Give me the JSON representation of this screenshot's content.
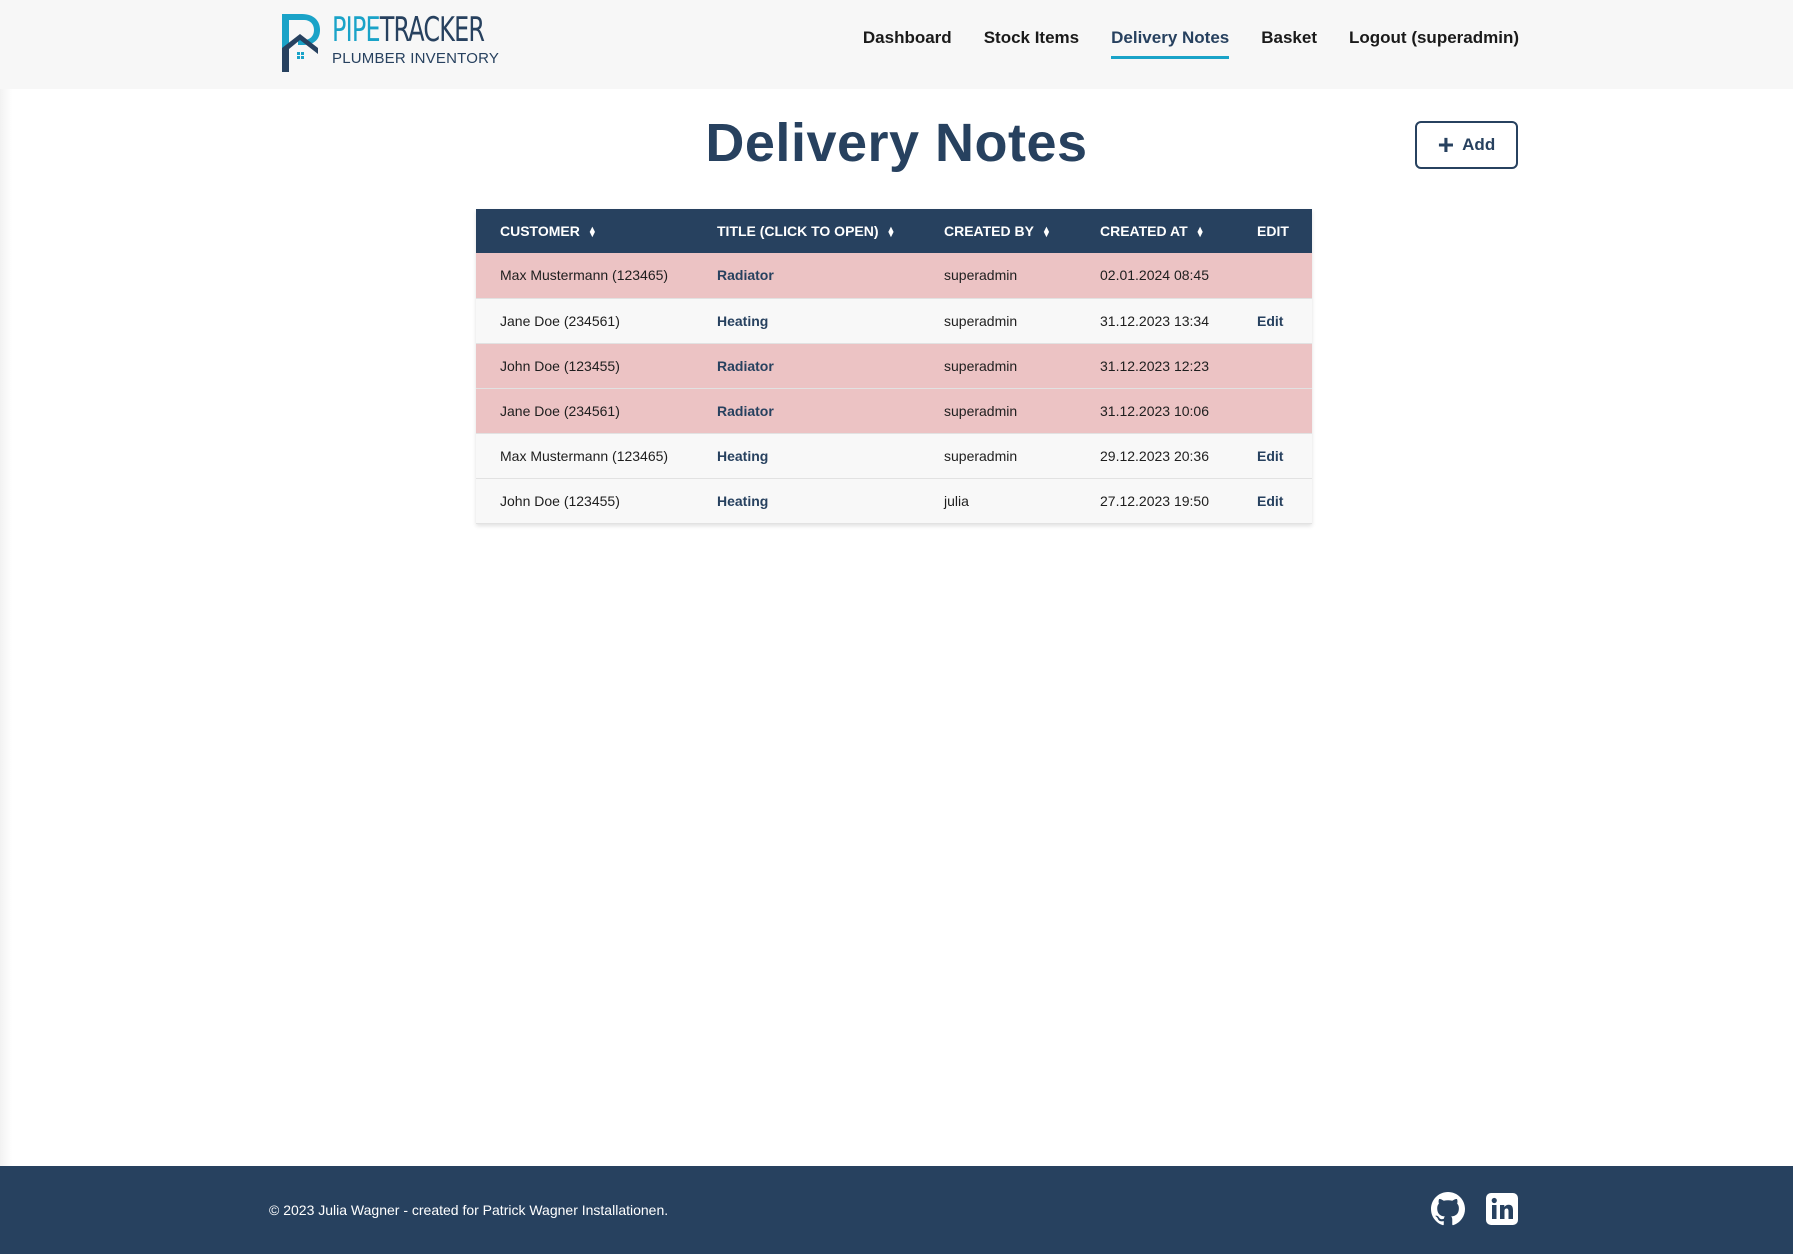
{
  "header": {
    "logo_pipe": "PIPE",
    "logo_tracker": "TRACKER",
    "logo_subtitle": "PLUMBER INVENTORY",
    "nav": [
      {
        "label": "Dashboard",
        "active": false
      },
      {
        "label": "Stock Items",
        "active": false
      },
      {
        "label": "Delivery Notes",
        "active": true
      },
      {
        "label": "Basket",
        "active": false
      },
      {
        "label": "Logout (superadmin)",
        "active": false
      }
    ]
  },
  "main": {
    "title": "Delivery Notes",
    "add_button_label": "Add",
    "table": {
      "columns": [
        "CUSTOMER",
        "TITLE (CLICK TO OPEN)",
        "CREATED BY",
        "CREATED AT",
        "EDIT"
      ],
      "rows": [
        {
          "customer": "Max Mustermann (123465)",
          "title": "Radiator",
          "created_by": "superadmin",
          "created_at": "02.01.2024 08:45",
          "edit": ""
        },
        {
          "customer": "Jane Doe (234561)",
          "title": "Heating",
          "created_by": "superadmin",
          "created_at": "31.12.2023 13:34",
          "edit": "Edit"
        },
        {
          "customer": "John Doe (123455)",
          "title": "Radiator",
          "created_by": "superadmin",
          "created_at": "31.12.2023 12:23",
          "edit": ""
        },
        {
          "customer": "Jane Doe (234561)",
          "title": "Radiator",
          "created_by": "superadmin",
          "created_at": "31.12.2023 10:06",
          "edit": ""
        },
        {
          "customer": "Max Mustermann (123465)",
          "title": "Heating",
          "created_by": "superadmin",
          "created_at": "29.12.2023 20:36",
          "edit": "Edit"
        },
        {
          "customer": "John Doe (123455)",
          "title": "Heating",
          "created_by": "julia",
          "created_at": "27.12.2023 19:50",
          "edit": "Edit"
        }
      ]
    }
  },
  "footer": {
    "copyright": "© 2023 Julia Wagner - created for Patrick Wagner Installationen.",
    "icons": [
      "github-icon",
      "linkedin-icon"
    ]
  },
  "colors": {
    "primary": "#27415f",
    "accent": "#1aa3c8",
    "row_highlight": "#ecc3c4",
    "row_normal": "#f8f8f8"
  }
}
